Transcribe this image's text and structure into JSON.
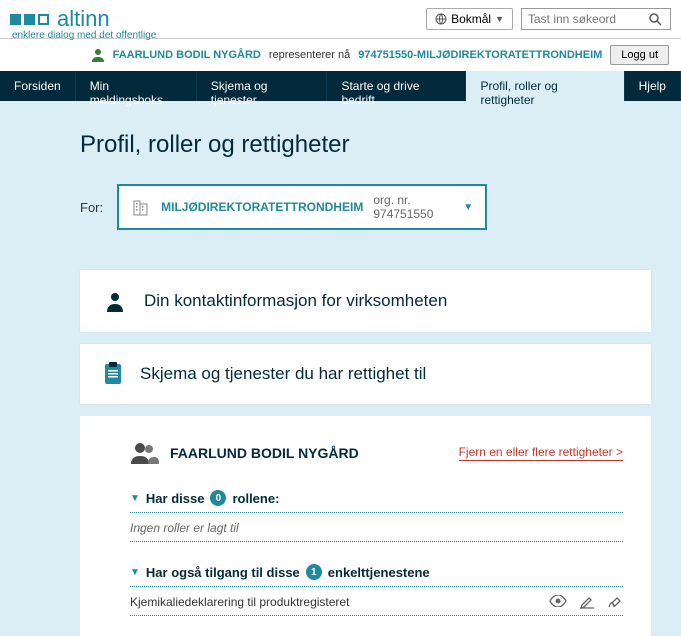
{
  "header": {
    "brand": "altinn",
    "tagline": "enklere dialog med det offentlige",
    "language_label": "Bokmål",
    "search_placeholder": "Tast inn søkeord",
    "user_name": "FAARLUND BODIL NYGÅRD",
    "represents_text": "representerer nå",
    "org_display": "974751550-MILJØDIREKTORATETTRONDHEIM",
    "logout_label": "Logg ut"
  },
  "nav": {
    "items": [
      {
        "label": "Forsiden"
      },
      {
        "label": "Min meldingsboks"
      },
      {
        "label": "Skjema og tjenester"
      },
      {
        "label": "Starte og drive bedrift"
      },
      {
        "label": "Profil, roller og rettigheter"
      },
      {
        "label": "Hjelp"
      }
    ],
    "active_index": 4
  },
  "page": {
    "title": "Profil, roller og rettigheter",
    "for_label": "For:",
    "selected_org_name": "MILJØDIREKTORATETTRONDHEIM",
    "selected_org_nr_label": "org. nr. 974751550"
  },
  "cards": {
    "contact_title": "Din kontaktinformasjon for virksomheten",
    "rights_title": "Skjema og tjenester du har rettighet til"
  },
  "rights_panel": {
    "person_name": "FAARLUND BODIL NYGÅRD",
    "remove_link": "Fjern en eller flere rettigheter >",
    "roles_heading_prefix": "Har disse",
    "roles_count": "0",
    "roles_heading_suffix": "rollene:",
    "roles_empty_text": "Ingen roller er lagt til",
    "services_heading_prefix": "Har også tilgang til disse",
    "services_count": "1",
    "services_heading_suffix": "enkelttjenestene",
    "services": [
      {
        "name": "Kjemikaliedeklarering til produktregisteret"
      }
    ]
  },
  "colors": {
    "brand": "#1f8a9e",
    "dark": "#022a3a",
    "bg": "#dbeef5",
    "danger": "#c0392b"
  }
}
